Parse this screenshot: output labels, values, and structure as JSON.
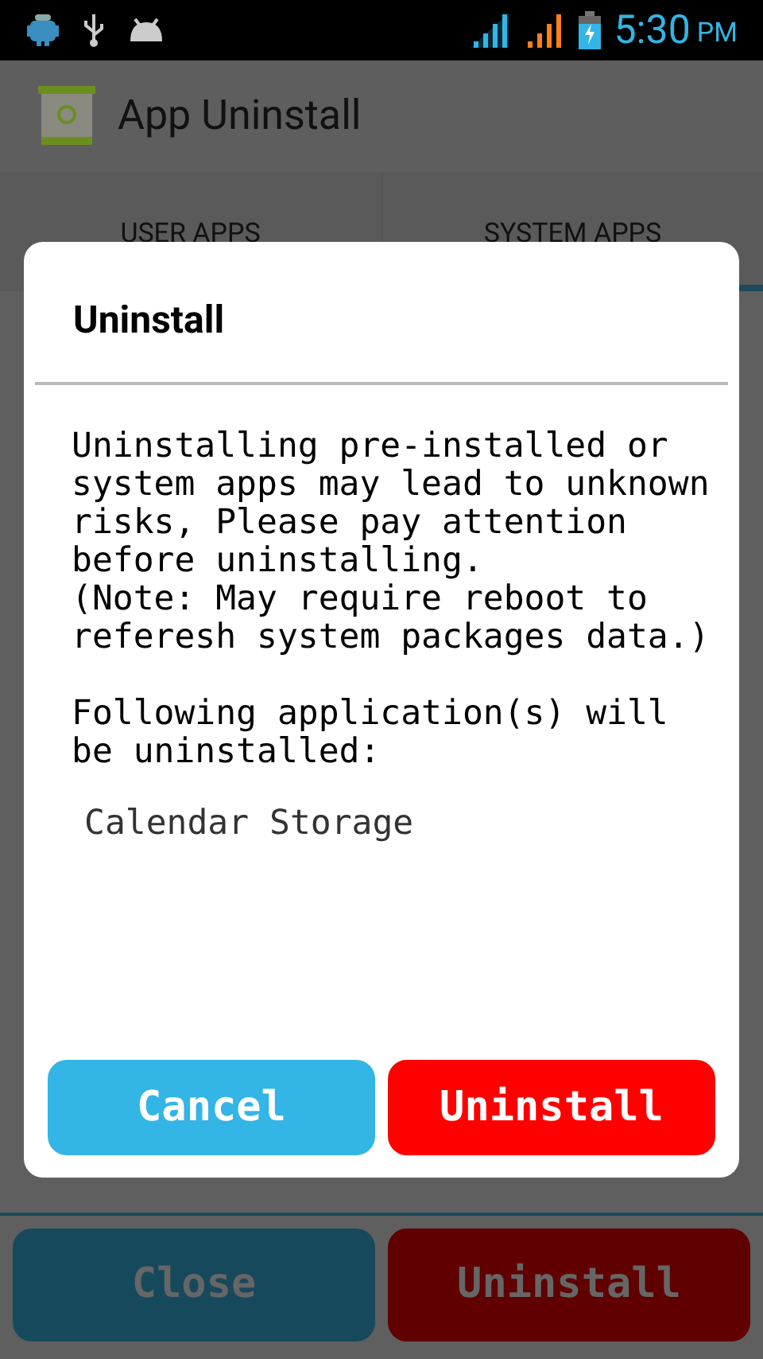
{
  "status_bar": {
    "time": "5:30",
    "ampm": "PM"
  },
  "app_bar": {
    "title": "App Uninstall"
  },
  "tabs": [
    {
      "label": "USER APPS",
      "selected": false
    },
    {
      "label": "SYSTEM APPS",
      "selected": true
    }
  ],
  "dialog": {
    "title": "Uninstall",
    "message": "Uninstalling pre-installed or system apps may lead to unknown risks, Please pay attention before uninstalling.",
    "note": "(Note: May require reboot to referesh system packages data.)",
    "list_heading": "Following application(s) will be uninstalled:",
    "apps": [
      "Calendar Storage"
    ],
    "buttons": [
      {
        "label": "Cancel",
        "kind": "cancel"
      },
      {
        "label": "Uninstall",
        "kind": "confirm"
      }
    ]
  },
  "bottom_buttons": [
    {
      "label": "Close",
      "kind": "cancel"
    },
    {
      "label": "Uninstall",
      "kind": "confirm"
    }
  ]
}
